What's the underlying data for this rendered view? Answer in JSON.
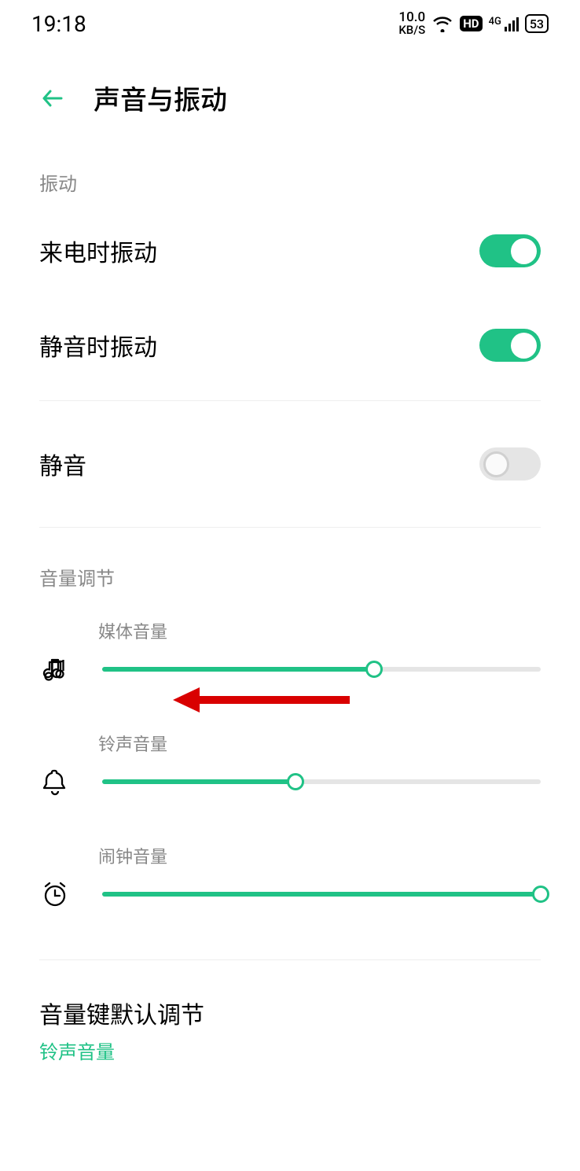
{
  "status": {
    "time": "19:18",
    "speed_top": "10.0",
    "speed_bottom": "KB/S",
    "hd": "HD",
    "network": "4G",
    "battery": "53"
  },
  "header": {
    "title": "声音与振动"
  },
  "sections": {
    "vibration": {
      "label": "振动",
      "items": [
        {
          "label": "来电时振动",
          "on": true
        },
        {
          "label": "静音时振动",
          "on": true
        }
      ]
    },
    "mute": {
      "label": "静音",
      "on": false
    },
    "volume": {
      "label": "音量调节",
      "sliders": {
        "media": {
          "label": "媒体音量",
          "value": 62
        },
        "ring": {
          "label": "铃声音量",
          "value": 44
        },
        "alarm": {
          "label": "闹钟音量",
          "value": 100
        }
      }
    },
    "default_key": {
      "title": "音量键默认调节",
      "subtitle": "铃声音量"
    }
  }
}
